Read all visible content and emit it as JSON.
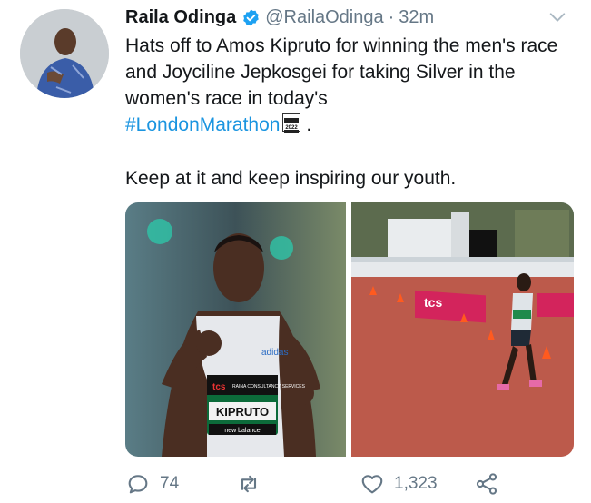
{
  "tweet": {
    "author_name": "Raila Odinga",
    "handle": "@RailaOdinga",
    "separator": "·",
    "timestamp": "32m",
    "text_part1": "Hats off to Amos Kipruto for winning the men's race and Joyciline Jepkosgei for taking Silver in the women's race in today's",
    "hashtag": "#LondonMarathon",
    "text_end": ".",
    "hashtag_badge": "2022",
    "paragraph2": "Keep at it and keep inspiring our youth.",
    "image1": {
      "bib_sponsor": "tcs",
      "bib_sub": "RAINA CONSULTANCY SERVICES",
      "bib_name": "KIPRUTO",
      "shoe_brand": "new balance",
      "shirt_logo": "adidas"
    },
    "image2": {
      "banner_text": "tcs"
    }
  },
  "actions": {
    "reply_count": "74",
    "retweet_count": "",
    "like_count": "1,323"
  },
  "colors": {
    "link": "#1b95e0",
    "secondary": "#657786",
    "verified": "#1da1f2"
  }
}
